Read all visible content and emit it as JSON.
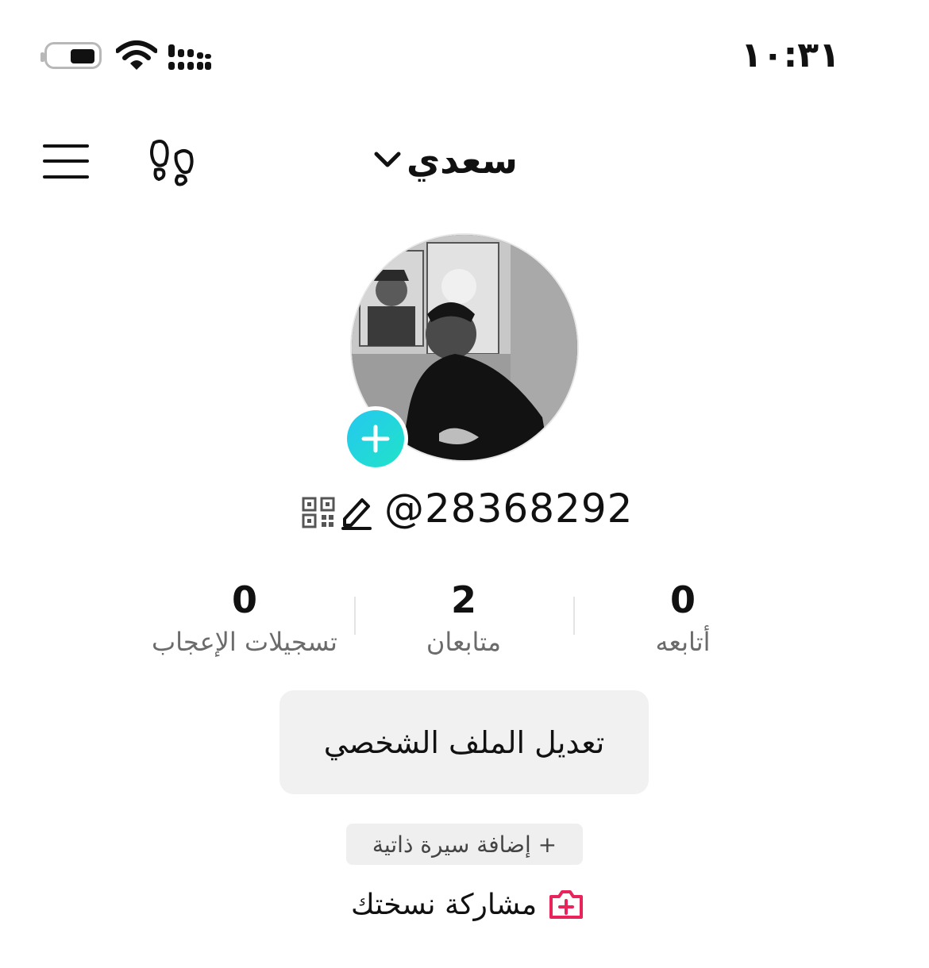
{
  "status_bar": {
    "time": "١٠:٣١"
  },
  "header": {
    "username_title": "سعدي"
  },
  "profile": {
    "handle": "@28368292"
  },
  "stats": [
    {
      "value": "0",
      "label": "تسجيلات الإعجاب"
    },
    {
      "value": "2",
      "label": "متابعان"
    },
    {
      "value": "0",
      "label": "أتابعه"
    }
  ],
  "actions": {
    "edit_profile": "تعديل الملف الشخصي",
    "add_bio": "+ إضافة سيرة ذاتية",
    "share_copy": "مشاركة نسختك"
  },
  "colors": {
    "accent_gradient_start": "#25c8f0",
    "accent_gradient_end": "#20e3c8",
    "share_icon": "#e8245b"
  },
  "icons": [
    "battery-icon",
    "wifi-icon",
    "signal-icon",
    "menu-icon",
    "footprints-icon",
    "chevron-down-icon",
    "plus-icon",
    "pencil-icon",
    "qr-code-icon",
    "add-photo-icon"
  ]
}
